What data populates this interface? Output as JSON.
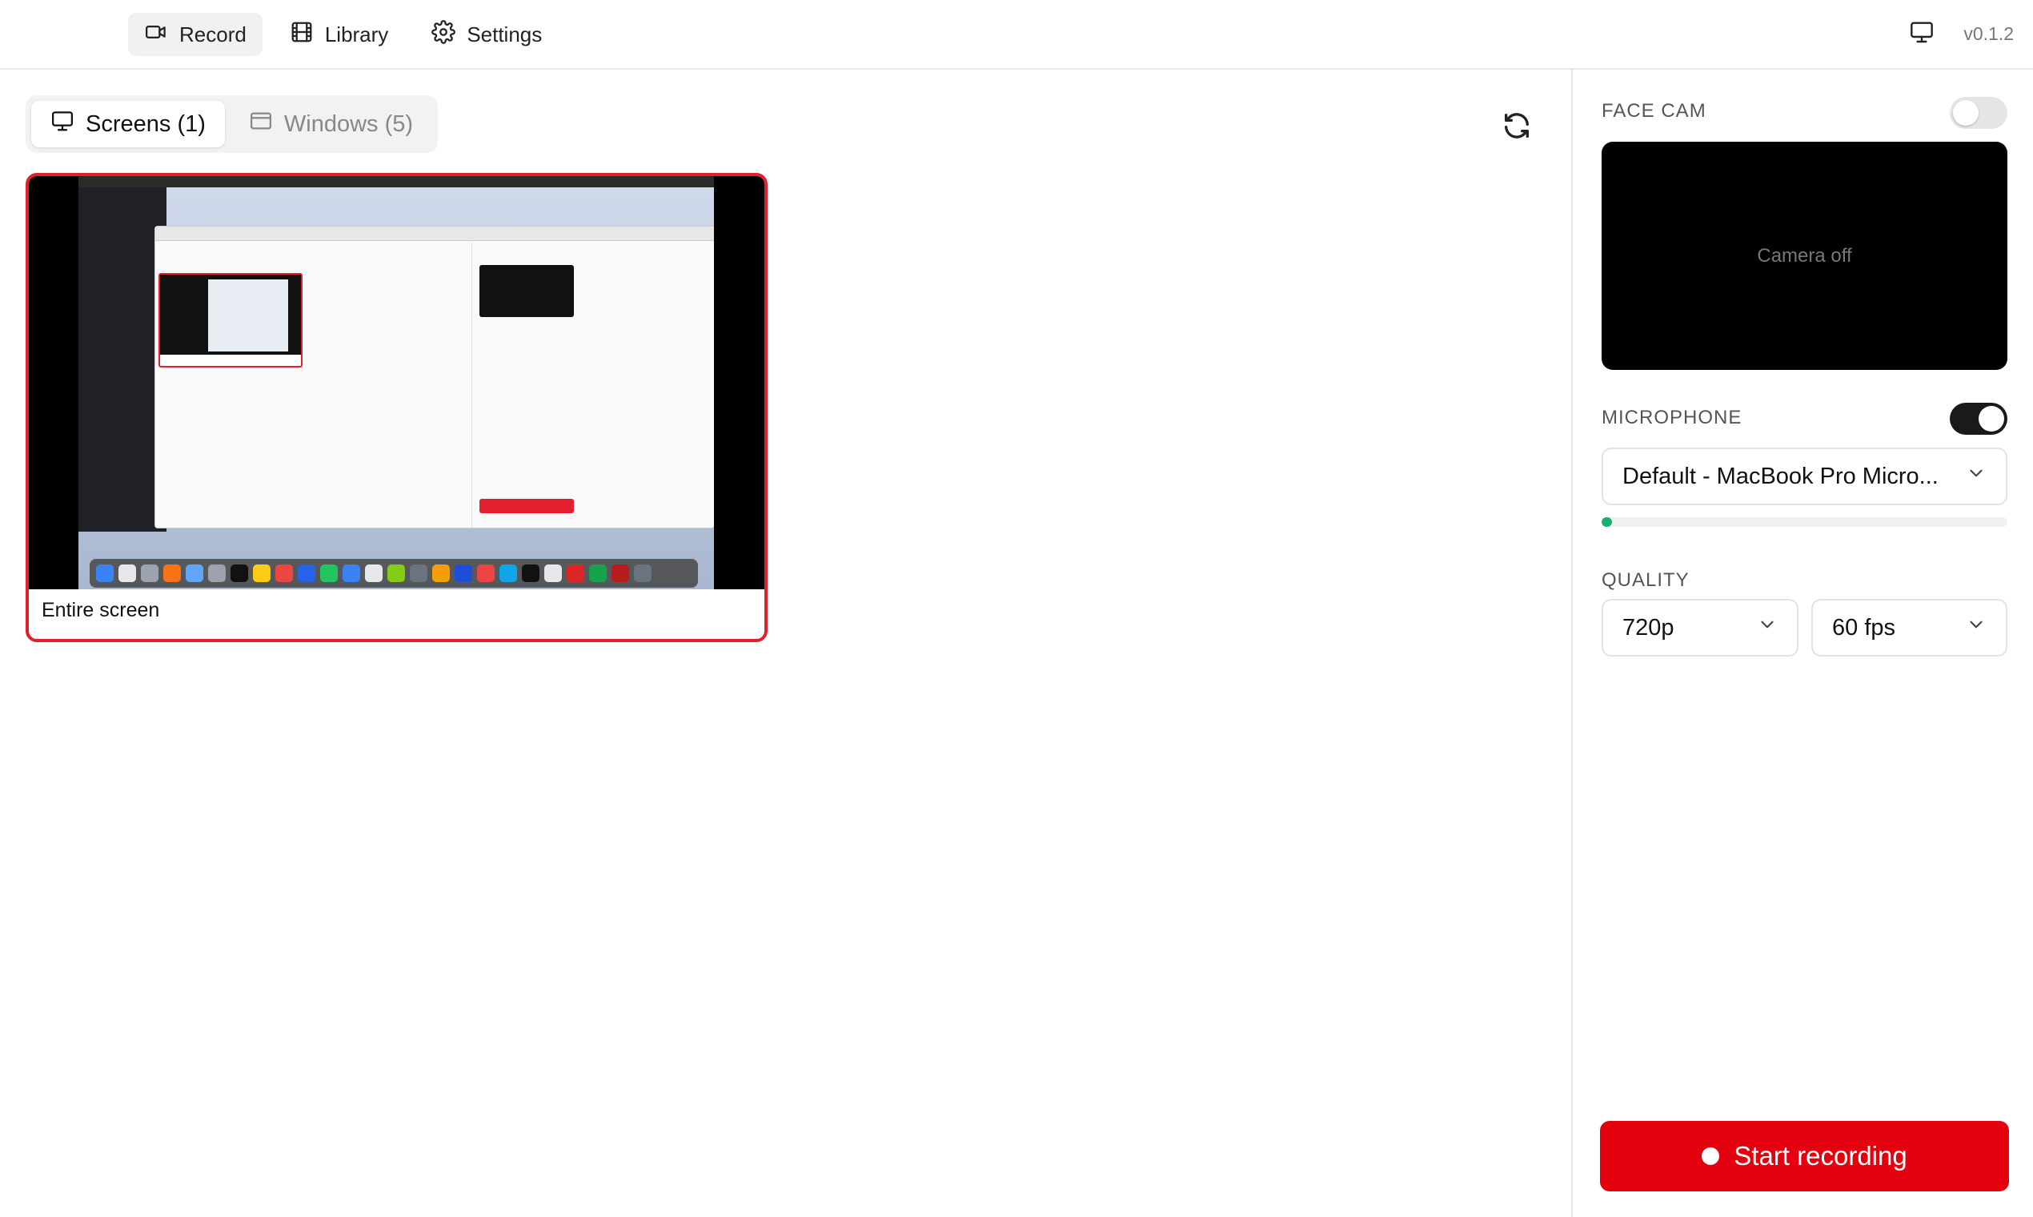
{
  "nav": {
    "items": [
      {
        "label": "Record",
        "icon": "video-camera-icon",
        "active": true
      },
      {
        "label": "Library",
        "icon": "film-icon",
        "active": false
      },
      {
        "label": "Settings",
        "icon": "gear-icon",
        "active": false
      }
    ],
    "version": "v0.1.2",
    "monitor_icon": "monitor-icon"
  },
  "source_tabs": [
    {
      "label": "Screens (1)",
      "icon": "monitor-icon",
      "active": true
    },
    {
      "label": "Windows (5)",
      "icon": "window-icon",
      "active": false
    }
  ],
  "refresh_icon": "refresh-icon",
  "sources": [
    {
      "label": "Entire screen",
      "selected": true
    }
  ],
  "sidebar": {
    "face_cam": {
      "label": "FACE CAM",
      "enabled": false,
      "placeholder": "Camera off"
    },
    "microphone": {
      "label": "MICROPHONE",
      "enabled": true,
      "device": "Default - MacBook Pro Micro...",
      "level": 0.025
    },
    "quality": {
      "label": "QUALITY",
      "resolution": "720p",
      "fps": "60 fps"
    },
    "start_label": "Start recording"
  },
  "colors": {
    "accent_red": "#e3000f",
    "selected_border": "#e21f2d",
    "level_green": "#18b26f",
    "toggle_on": "#1a1a1a"
  }
}
